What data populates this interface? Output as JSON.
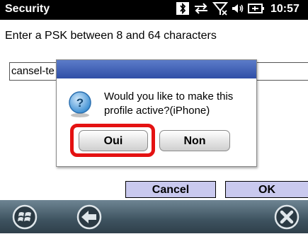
{
  "statusbar": {
    "title": "Security",
    "time": "10:57",
    "icons": [
      "bluetooth-icon",
      "data-sync-icon",
      "no-signal-icon",
      "volume-icon",
      "battery-icon"
    ]
  },
  "page": {
    "prompt": "Enter a PSK between 8 and 64 characters",
    "psk_value": "cansel-te"
  },
  "dialog": {
    "message": "Would you like to make this profile active?(iPhone)",
    "yes_label": "Oui",
    "no_label": "Non",
    "icon": "question-icon"
  },
  "buttons": {
    "cancel_label": "Cancel",
    "ok_label": "OK"
  },
  "taskbar": {
    "icons": [
      "windows-start-icon",
      "back-arrow-icon",
      "close-icon"
    ]
  },
  "colors": {
    "highlight": "#e41212",
    "button_fill": "#c9c9ee",
    "dialog_titlebar": "#3d5cb4"
  }
}
